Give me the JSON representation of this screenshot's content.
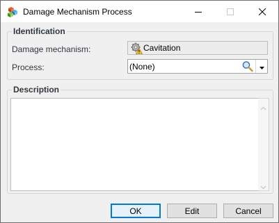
{
  "window": {
    "title": "Damage Mechanism Process",
    "app_icon": "cubes-icon",
    "controls": {
      "minimize": "minimize-icon",
      "maximize": "maximize-icon",
      "close": "close-icon"
    }
  },
  "identification": {
    "group_title": "Identification",
    "damage_mechanism": {
      "label": "Damage mechanism:",
      "value": "Cavitation",
      "icon": "gear-warning-icon"
    },
    "process": {
      "label": "Process:",
      "value": "(None)",
      "search_icon": "magnifier-icon",
      "dropdown_icon": "chevron-down-icon"
    }
  },
  "description": {
    "group_title": "Description",
    "value": ""
  },
  "buttons": {
    "ok": "OK",
    "edit": "Edit",
    "cancel": "Cancel"
  },
  "colors": {
    "accent": "#0078d7",
    "group_label": "#30373f"
  }
}
